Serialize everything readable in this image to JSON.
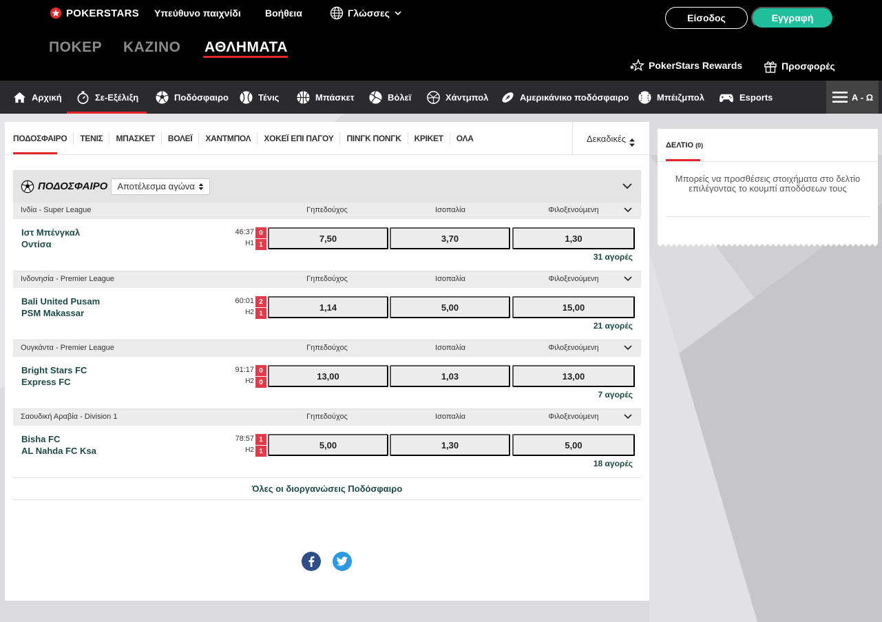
{
  "header": {
    "brand": "POKERSTARS",
    "links": [
      "Υπεύθυνο παιχνίδι",
      "Βοήθεια"
    ],
    "language_label": "Γλώσσες",
    "login_label": "Είσοδος",
    "register_label": "Εγγραφή",
    "products": [
      "ΠΟΚΕΡ",
      "ΚΑΖΙΝΟ",
      "ΑΘΛΗΜΑΤΑ"
    ],
    "rewards_label": "PokerStars Rewards",
    "promos_label": "Προσφορές"
  },
  "sports_nav": {
    "items": [
      {
        "label": "Αρχική",
        "icon": "home-icon"
      },
      {
        "label": "Σε-Εξέλιξη",
        "icon": "stopwatch-icon"
      },
      {
        "label": "Ποδόσφαιρο",
        "icon": "soccer-ball-icon"
      },
      {
        "label": "Τένις",
        "icon": "tennis-ball-icon"
      },
      {
        "label": "Μπάσκετ",
        "icon": "basketball-icon"
      },
      {
        "label": "Βόλεϊ",
        "icon": "volleyball-icon"
      },
      {
        "label": "Χάντμπολ",
        "icon": "handball-icon"
      },
      {
        "label": "Αμερικάνικο ποδόσφαιρο",
        "icon": "american-football-icon"
      },
      {
        "label": "Μπέιζμπολ",
        "icon": "baseball-icon"
      },
      {
        "label": "Esports",
        "icon": "gamepad-icon"
      }
    ],
    "az_label": "Α - Ω"
  },
  "main": {
    "tabs": [
      "ΠΟΔΟΣΦΑΙΡΟ",
      "ΤΕΝΙΣ",
      "ΜΠΑΣΚΕΤ",
      "ΒΟΛΕΪ",
      "ΧΑΝΤΜΠΟΛ",
      "ΧΟΚΕΪ ΕΠΙ ΠΑΓΟΥ",
      "ΠΙΝΓΚ ΠΟΝΓΚ",
      "ΚΡΙΚΕΤ",
      "ΟΛΑ"
    ],
    "odds_format": "Δεκαδικές",
    "section_title": "ΠΟΔΟΣΦΑΙΡΟ",
    "market_select": "Αποτέλεσμα αγώνα",
    "column_headers": [
      "Γηπεδούχος",
      "Ισοπαλία",
      "Φιλοξενούμενη"
    ],
    "events": [
      {
        "league": "Ινδία - Super League",
        "home": "Ιστ Μπένγκαλ",
        "away": "Οντίσα",
        "time": "46:37",
        "period": "H1",
        "score_home": "0",
        "score_away": "1",
        "odds": [
          "7,50",
          "3,70",
          "1,30"
        ],
        "markets": "31 αγορές"
      },
      {
        "league": "Ινδονησία - Premier League",
        "home": "Bali United Pusam",
        "away": "PSM Makassar",
        "time": "60:01",
        "period": "H2",
        "score_home": "2",
        "score_away": "1",
        "odds": [
          "1,14",
          "5,00",
          "15,00"
        ],
        "markets": "21 αγορές"
      },
      {
        "league": "Ουγκάντα - Premier League",
        "home": "Bright Stars FC",
        "away": "Express FC",
        "time": "91:17",
        "period": "H2",
        "score_home": "0",
        "score_away": "0",
        "odds": [
          "13,00",
          "1,03",
          "13,00"
        ],
        "markets": "7 αγορές"
      },
      {
        "league": "Σαουδική Αραβία - Division 1",
        "home": "Bisha FC",
        "away": "AL Nahda FC Ksa",
        "time": "78:57",
        "period": "H2",
        "score_home": "1",
        "score_away": "1",
        "odds": [
          "5,00",
          "1,30",
          "5,00"
        ],
        "markets": "18 αγορές"
      }
    ],
    "all_competitions": "Όλες οι διοργανώσεις Ποδόσφαιρο"
  },
  "betslip": {
    "tab_label": "ΔΕΛΤΙΟ",
    "count": "(0)",
    "message": "Μπορείς να προσθέσεις στοιχήματα στο δελτίο επιλέγοντας το κουμπί αποδόσεων τους"
  },
  "colors": {
    "accent_red": "#e4262b",
    "register_green": "#1fbf9c",
    "team_text": "#1e4a44",
    "score_red": "#e8394a"
  }
}
